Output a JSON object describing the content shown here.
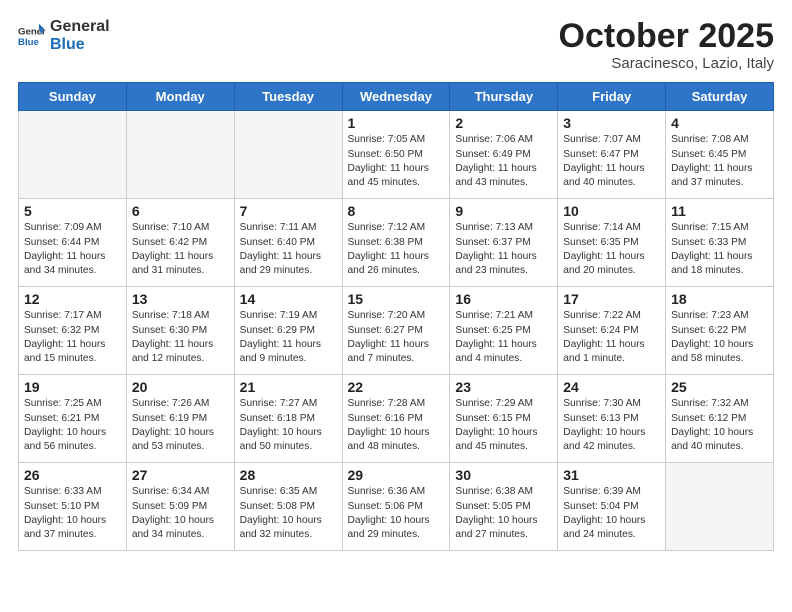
{
  "logo": {
    "general": "General",
    "blue": "Blue"
  },
  "title": "October 2025",
  "location": "Saracinesco, Lazio, Italy",
  "days_header": [
    "Sunday",
    "Monday",
    "Tuesday",
    "Wednesday",
    "Thursday",
    "Friday",
    "Saturday"
  ],
  "weeks": [
    [
      {
        "num": "",
        "info": ""
      },
      {
        "num": "",
        "info": ""
      },
      {
        "num": "",
        "info": ""
      },
      {
        "num": "1",
        "info": "Sunrise: 7:05 AM\nSunset: 6:50 PM\nDaylight: 11 hours\nand 45 minutes."
      },
      {
        "num": "2",
        "info": "Sunrise: 7:06 AM\nSunset: 6:49 PM\nDaylight: 11 hours\nand 43 minutes."
      },
      {
        "num": "3",
        "info": "Sunrise: 7:07 AM\nSunset: 6:47 PM\nDaylight: 11 hours\nand 40 minutes."
      },
      {
        "num": "4",
        "info": "Sunrise: 7:08 AM\nSunset: 6:45 PM\nDaylight: 11 hours\nand 37 minutes."
      }
    ],
    [
      {
        "num": "5",
        "info": "Sunrise: 7:09 AM\nSunset: 6:44 PM\nDaylight: 11 hours\nand 34 minutes."
      },
      {
        "num": "6",
        "info": "Sunrise: 7:10 AM\nSunset: 6:42 PM\nDaylight: 11 hours\nand 31 minutes."
      },
      {
        "num": "7",
        "info": "Sunrise: 7:11 AM\nSunset: 6:40 PM\nDaylight: 11 hours\nand 29 minutes."
      },
      {
        "num": "8",
        "info": "Sunrise: 7:12 AM\nSunset: 6:38 PM\nDaylight: 11 hours\nand 26 minutes."
      },
      {
        "num": "9",
        "info": "Sunrise: 7:13 AM\nSunset: 6:37 PM\nDaylight: 11 hours\nand 23 minutes."
      },
      {
        "num": "10",
        "info": "Sunrise: 7:14 AM\nSunset: 6:35 PM\nDaylight: 11 hours\nand 20 minutes."
      },
      {
        "num": "11",
        "info": "Sunrise: 7:15 AM\nSunset: 6:33 PM\nDaylight: 11 hours\nand 18 minutes."
      }
    ],
    [
      {
        "num": "12",
        "info": "Sunrise: 7:17 AM\nSunset: 6:32 PM\nDaylight: 11 hours\nand 15 minutes."
      },
      {
        "num": "13",
        "info": "Sunrise: 7:18 AM\nSunset: 6:30 PM\nDaylight: 11 hours\nand 12 minutes."
      },
      {
        "num": "14",
        "info": "Sunrise: 7:19 AM\nSunset: 6:29 PM\nDaylight: 11 hours\nand 9 minutes."
      },
      {
        "num": "15",
        "info": "Sunrise: 7:20 AM\nSunset: 6:27 PM\nDaylight: 11 hours\nand 7 minutes."
      },
      {
        "num": "16",
        "info": "Sunrise: 7:21 AM\nSunset: 6:25 PM\nDaylight: 11 hours\nand 4 minutes."
      },
      {
        "num": "17",
        "info": "Sunrise: 7:22 AM\nSunset: 6:24 PM\nDaylight: 11 hours\nand 1 minute."
      },
      {
        "num": "18",
        "info": "Sunrise: 7:23 AM\nSunset: 6:22 PM\nDaylight: 10 hours\nand 58 minutes."
      }
    ],
    [
      {
        "num": "19",
        "info": "Sunrise: 7:25 AM\nSunset: 6:21 PM\nDaylight: 10 hours\nand 56 minutes."
      },
      {
        "num": "20",
        "info": "Sunrise: 7:26 AM\nSunset: 6:19 PM\nDaylight: 10 hours\nand 53 minutes."
      },
      {
        "num": "21",
        "info": "Sunrise: 7:27 AM\nSunset: 6:18 PM\nDaylight: 10 hours\nand 50 minutes."
      },
      {
        "num": "22",
        "info": "Sunrise: 7:28 AM\nSunset: 6:16 PM\nDaylight: 10 hours\nand 48 minutes."
      },
      {
        "num": "23",
        "info": "Sunrise: 7:29 AM\nSunset: 6:15 PM\nDaylight: 10 hours\nand 45 minutes."
      },
      {
        "num": "24",
        "info": "Sunrise: 7:30 AM\nSunset: 6:13 PM\nDaylight: 10 hours\nand 42 minutes."
      },
      {
        "num": "25",
        "info": "Sunrise: 7:32 AM\nSunset: 6:12 PM\nDaylight: 10 hours\nand 40 minutes."
      }
    ],
    [
      {
        "num": "26",
        "info": "Sunrise: 6:33 AM\nSunset: 5:10 PM\nDaylight: 10 hours\nand 37 minutes."
      },
      {
        "num": "27",
        "info": "Sunrise: 6:34 AM\nSunset: 5:09 PM\nDaylight: 10 hours\nand 34 minutes."
      },
      {
        "num": "28",
        "info": "Sunrise: 6:35 AM\nSunset: 5:08 PM\nDaylight: 10 hours\nand 32 minutes."
      },
      {
        "num": "29",
        "info": "Sunrise: 6:36 AM\nSunset: 5:06 PM\nDaylight: 10 hours\nand 29 minutes."
      },
      {
        "num": "30",
        "info": "Sunrise: 6:38 AM\nSunset: 5:05 PM\nDaylight: 10 hours\nand 27 minutes."
      },
      {
        "num": "31",
        "info": "Sunrise: 6:39 AM\nSunset: 5:04 PM\nDaylight: 10 hours\nand 24 minutes."
      },
      {
        "num": "",
        "info": ""
      }
    ]
  ]
}
